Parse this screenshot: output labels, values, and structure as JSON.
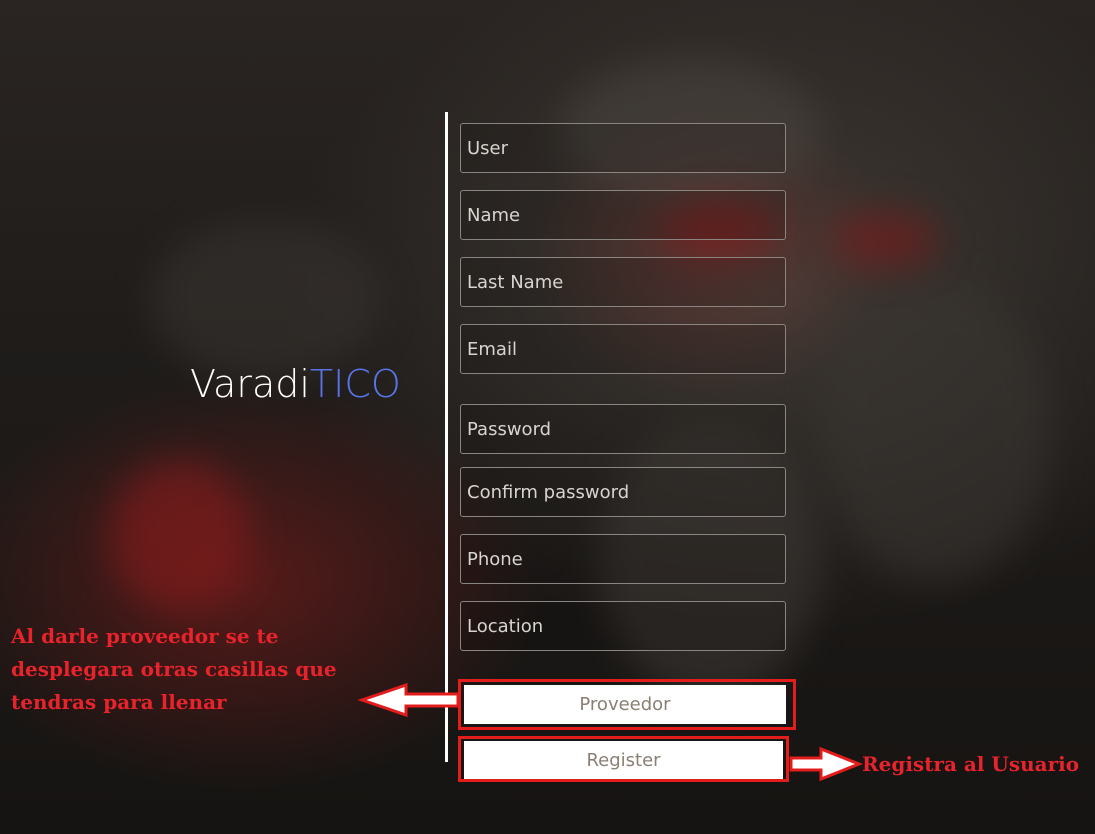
{
  "brand": {
    "name": "Varadi",
    "accent": "TICO"
  },
  "form": {
    "user_placeholder": "User",
    "name_placeholder": "Name",
    "lastname_placeholder": "Last Name",
    "email_placeholder": "Email",
    "password_placeholder": "Password",
    "confirm_placeholder": "Confirm password",
    "phone_placeholder": "Phone",
    "location_placeholder": "Location"
  },
  "buttons": {
    "proveedor": "Proveedor",
    "register": "Register"
  },
  "annotations": {
    "left_line1": "Al darle proveedor se te",
    "left_line2": "desplegara otras casillas que",
    "left_line3": "tendras para llenar",
    "right": "Registra al Usuario"
  },
  "colors": {
    "accent": "#5a74e8",
    "annotation_red": "#e31c1c"
  }
}
